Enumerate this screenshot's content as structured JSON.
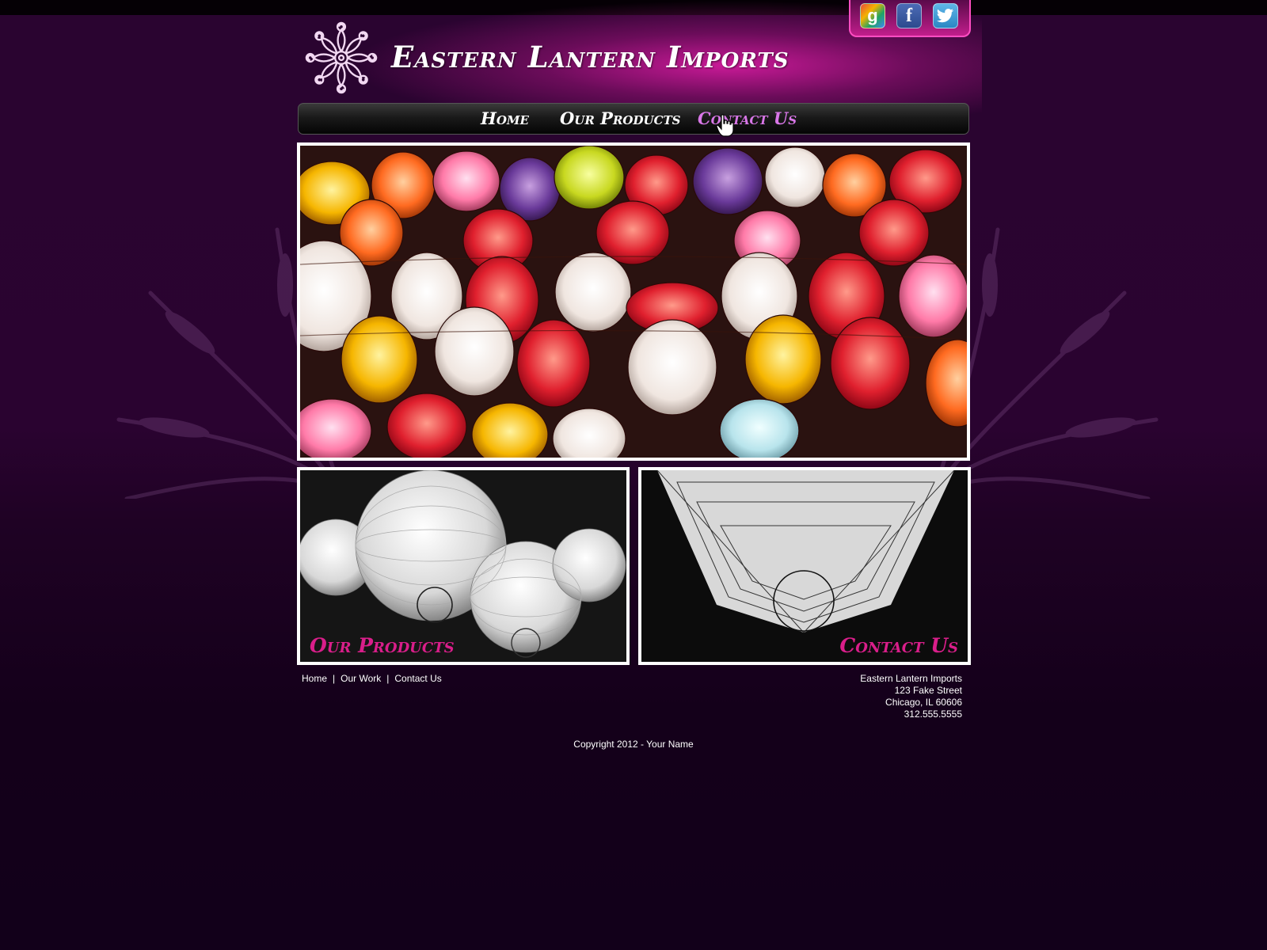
{
  "site": {
    "title": "Eastern Lantern Imports"
  },
  "social": {
    "items": [
      {
        "name": "google",
        "glyph": "g"
      },
      {
        "name": "facebook",
        "glyph": "f"
      },
      {
        "name": "twitter",
        "glyph": "t"
      }
    ]
  },
  "nav": {
    "home": "Home",
    "products": "Our Products",
    "contact": "Contact Us",
    "active_color": "#d977e8"
  },
  "panels": {
    "products_caption": "Our Products",
    "contact_caption": "Contact Us",
    "caption_color": "#d91e8a"
  },
  "footer": {
    "links": [
      "Home",
      "Our Work",
      "Contact Us"
    ],
    "separator": "|",
    "address": {
      "company": "Eastern Lantern Imports",
      "street": "123 Fake Street",
      "city": "Chicago, IL 60606",
      "phone": "312.555.5555"
    },
    "copyright": "Copyright 2012 - Your Name"
  },
  "colors": {
    "background": "#1f0224",
    "accent_pink": "#c21e8c"
  }
}
